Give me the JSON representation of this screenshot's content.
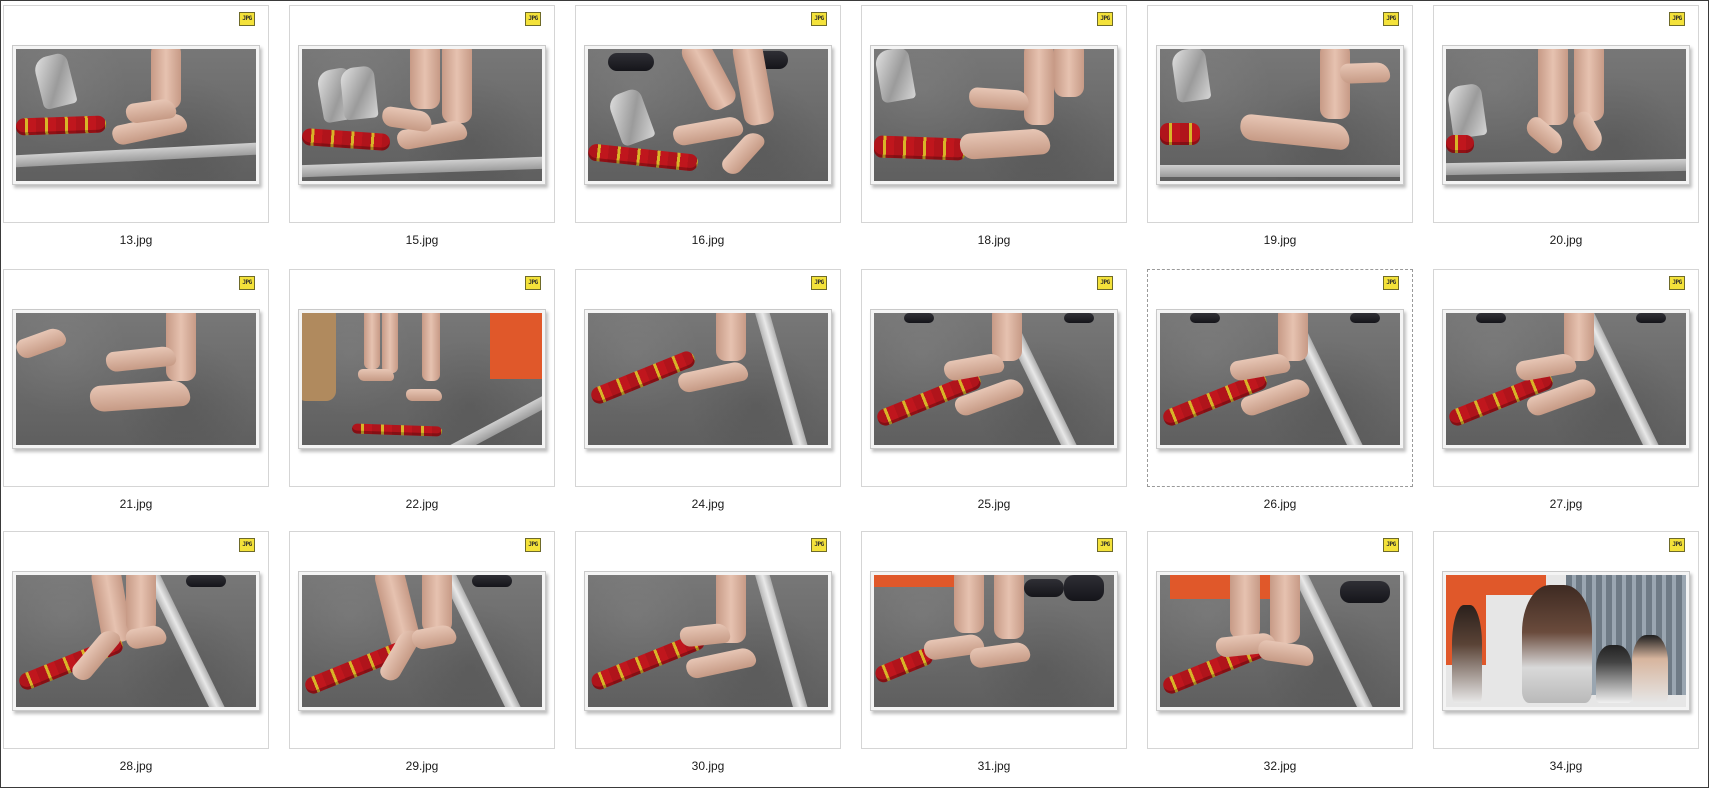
{
  "view": {
    "badge_text": "JPG",
    "selected_item": "26.jpg"
  },
  "files": [
    {
      "name": "13.jpg"
    },
    {
      "name": "15.jpg"
    },
    {
      "name": "16.jpg"
    },
    {
      "name": "18.jpg"
    },
    {
      "name": "19.jpg"
    },
    {
      "name": "20.jpg"
    },
    {
      "name": "21.jpg"
    },
    {
      "name": "22.jpg"
    },
    {
      "name": "24.jpg"
    },
    {
      "name": "25.jpg"
    },
    {
      "name": "26.jpg"
    },
    {
      "name": "27.jpg"
    },
    {
      "name": "28.jpg"
    },
    {
      "name": "29.jpg"
    },
    {
      "name": "30.jpg"
    },
    {
      "name": "31.jpg"
    },
    {
      "name": "32.jpg"
    },
    {
      "name": "34.jpg"
    }
  ],
  "colors": {
    "tile_border": "#d5d5d5",
    "badge_fill": "#f4e23a",
    "window_border": "#3a3a3a"
  }
}
